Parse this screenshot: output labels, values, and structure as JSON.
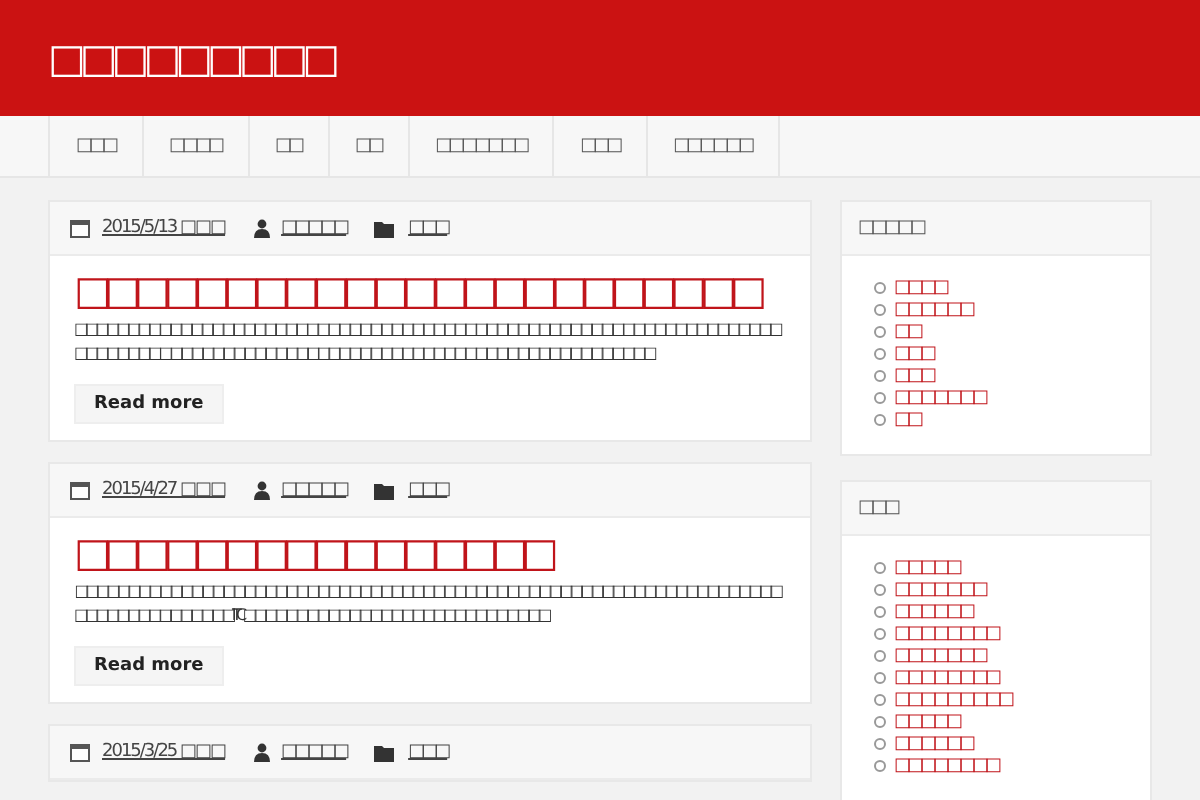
{
  "site_title": "□□□□□□□□□",
  "nav": [
    {
      "label": "□□□"
    },
    {
      "label": "□□□□"
    },
    {
      "label": "□□"
    },
    {
      "label": "□□"
    },
    {
      "label": "□□□□□□□"
    },
    {
      "label": "□□□"
    },
    {
      "label": "□□□□□□"
    }
  ],
  "posts": [
    {
      "date": "2015/5/13 □□□",
      "author": "□□□□□",
      "category": "□□□",
      "title": "□□□□□□□□□□□□□□□□□□□□□□□",
      "excerpt": "□□□□□□□□□□□□□□□□□□□□□□□□ □□□□□□□□□□□□□□□□□□□□□□□□□□□□□□□□□□□□□□□□□□□□□□□□□□□ □□□□□□□□□□□□□□□□□□□□□□□□□□□□□□□□□□□□□□□□□□□□□□□",
      "button": "Read more"
    },
    {
      "date": "2015/4/27 □□□",
      "author": "□□□□□",
      "category": "□□□",
      "title": "□□□□□□□□□□□□□□□□",
      "excerpt": " □□□□□□□□□□□□□□□□□□□□□□□□□□□□□□□□□□□□□□□□□□ □□□□□□□□□□□□□□□□□□□□□□□□□□□□□□□□□□□□□□□□ITC□□□□□□□□□□□□□□□□□□□□□□□□□□□□□",
      "button": "Read more"
    },
    {
      "date": "2015/3/25 □□□",
      "author": "□□□□□",
      "category": "□□□"
    }
  ],
  "widgets": [
    {
      "title": "□□□□□",
      "items": [
        "□□□□",
        "□□□□□□",
        "□□",
        "□□□",
        "□□□",
        "□□□□□□□",
        "□□"
      ]
    },
    {
      "title": "□□□",
      "items": [
        "□□□□□",
        "□□□□□□□",
        "□□□□□□",
        "□□□□□□□□",
        "□□□□□□□",
        "□□□□□□□□",
        "□□□□□□□□□",
        "□□□□□",
        "□□□□□□",
        "□□□□□□□□"
      ]
    }
  ]
}
